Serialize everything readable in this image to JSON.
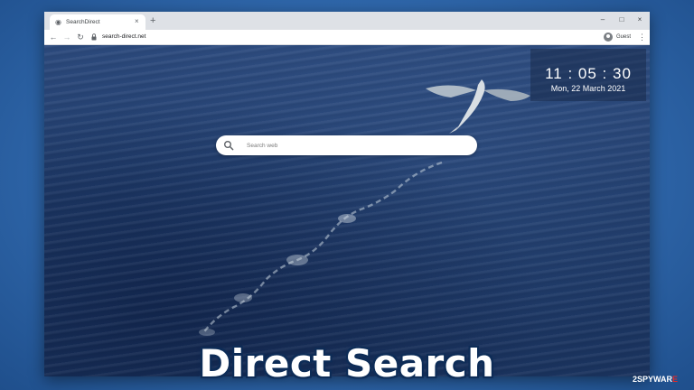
{
  "browser": {
    "tab": {
      "title": "SearchDirect",
      "close_glyph": "×",
      "favicon": "globe-icon"
    },
    "new_tab_glyph": "+",
    "window_controls": {
      "minimize": "–",
      "maximize": "□",
      "close": "×"
    },
    "nav": {
      "back": "←",
      "forward": "→",
      "reload": "↻"
    },
    "address": {
      "url": "search-direct.net"
    },
    "profile": {
      "label": "Guest"
    },
    "menu_glyph": "⋮"
  },
  "page": {
    "clock": {
      "time": "11 : 05 : 30",
      "date": "Mon, 22 March 2021"
    },
    "search": {
      "placeholder": "Search web",
      "value": ""
    }
  },
  "overlay": {
    "caption": "Direct Search",
    "watermark": {
      "prefix": "2SPYWAR",
      "accent": "E"
    }
  },
  "colors": {
    "backdrop": "#2f67ab",
    "caption_outline": "#0d2c57",
    "watermark_accent": "#e32b2b"
  }
}
